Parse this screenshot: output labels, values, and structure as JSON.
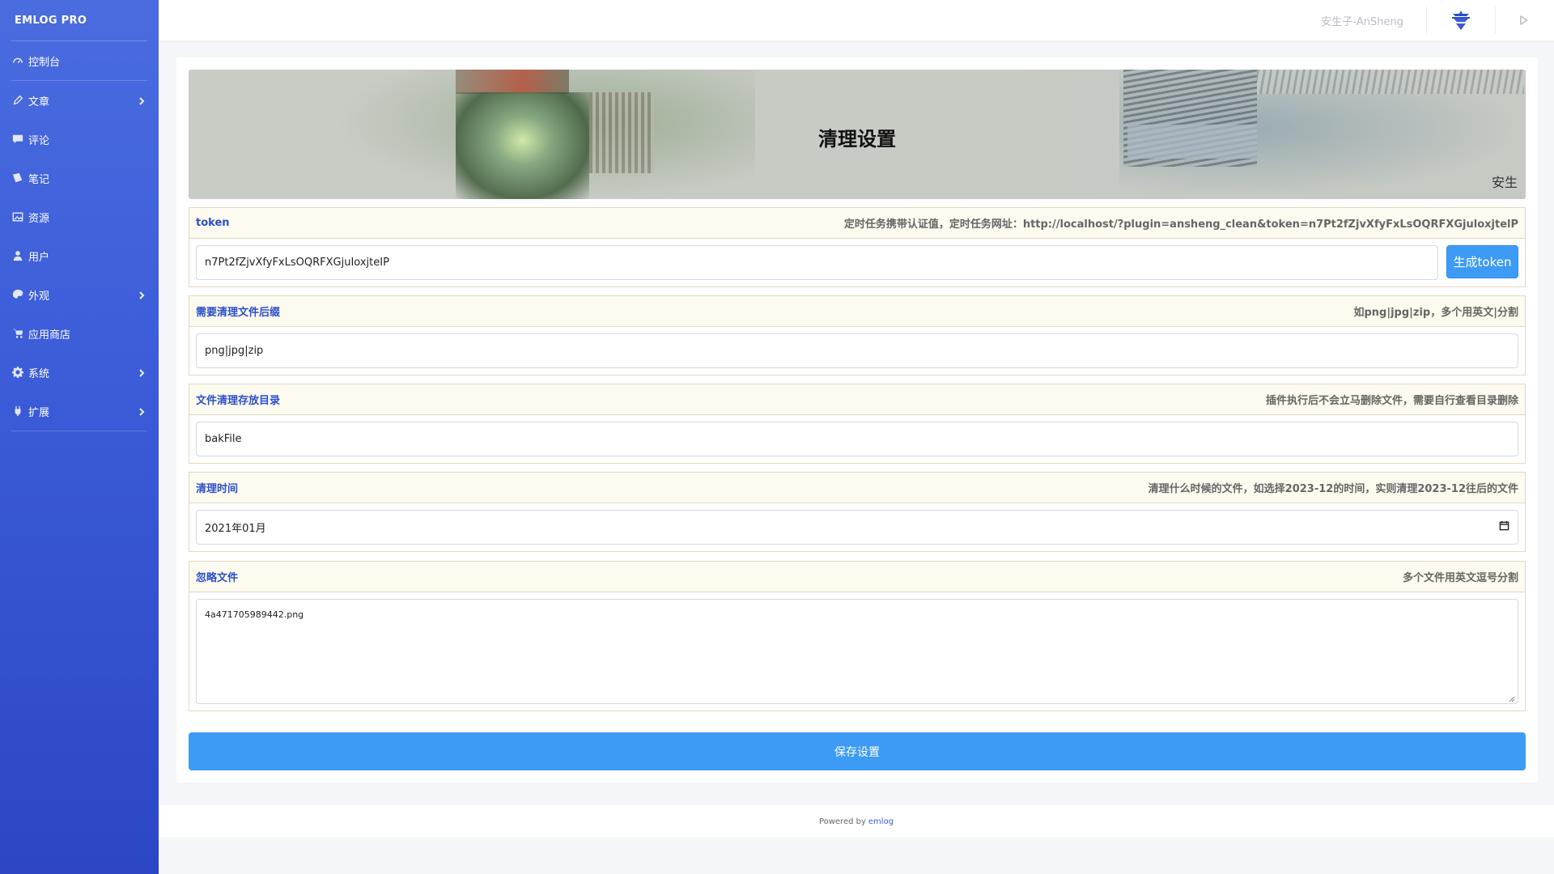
{
  "brand": "EMLOG PRO",
  "sidebar": {
    "items": [
      {
        "label": "控制台",
        "icon": "dashboard-icon",
        "has_submenu": false
      },
      {
        "label": "文章",
        "icon": "pencil-icon",
        "has_submenu": true
      },
      {
        "label": "评论",
        "icon": "comment-icon",
        "has_submenu": false
      },
      {
        "label": "笔记",
        "icon": "note-icon",
        "has_submenu": false
      },
      {
        "label": "资源",
        "icon": "image-icon",
        "has_submenu": false
      },
      {
        "label": "用户",
        "icon": "user-icon",
        "has_submenu": false
      },
      {
        "label": "外观",
        "icon": "palette-icon",
        "has_submenu": true
      },
      {
        "label": "应用商店",
        "icon": "cart-icon",
        "has_submenu": false
      },
      {
        "label": "系统",
        "icon": "gear-icon",
        "has_submenu": true
      },
      {
        "label": "扩展",
        "icon": "plug-icon",
        "has_submenu": true
      }
    ]
  },
  "topbar": {
    "username": "安生子-AnSheng",
    "avatar_icon": "avatar-icon",
    "logout_icon": "logout-icon"
  },
  "banner": {
    "title": "清理设置",
    "subtitle": "安生"
  },
  "form": {
    "token": {
      "label": "token",
      "hint": "定时任务携带认证值，定时任务网址：http://localhost/?plugin=ansheng_clean&token=n7Pt2fZjvXfyFxLsOQRFXGjuloxjtelP",
      "value": "n7Pt2fZjvXfyFxLsOQRFXGjuIoxjteIP",
      "button": "生成token"
    },
    "suffix": {
      "label": "需要清理文件后缀",
      "hint": "如png|jpg|zip，多个用英文|分割",
      "value": "png|jpg|zip"
    },
    "dir": {
      "label": "文件清理存放目录",
      "hint": "插件执行后不会立马删除文件，需要自行查看目录删除",
      "value": "bakFile"
    },
    "time": {
      "label": "清理时间",
      "hint": "清理什么时候的文件，如选择2023-12的时间，实则清理2023-12往后的文件",
      "value": "2021年01月"
    },
    "ignore": {
      "label": "忽略文件",
      "hint": "多个文件用英文逗号分割",
      "value": "4a471705989442.png"
    },
    "save_button": "保存设置"
  },
  "footer": {
    "prefix": "Powered by",
    "link": "emlog"
  }
}
